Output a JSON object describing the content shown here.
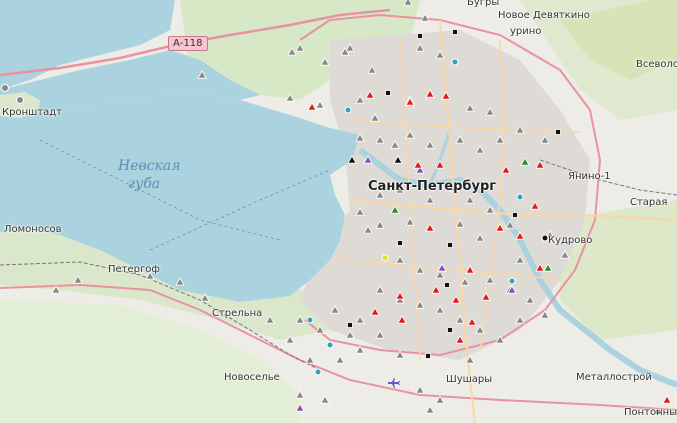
{
  "map": {
    "water_label_1": "Невская",
    "water_label_2": "губа",
    "road_shield": "А-118",
    "places": {
      "bugry": "Бугры",
      "novoe_devyatkino": "Новое Девяткино",
      "murino": "урино",
      "vsevolozhsk": "Всеволо",
      "kronshtadt": "Кронштадт",
      "spb": "Санкт-Петербург",
      "yanino": "Янино-1",
      "staraya": "Старая",
      "kudrovo": "Кудрово",
      "lomonosov": "Ломоносов",
      "peterhof": "Петергоф",
      "strelna": "Стрельна",
      "novoselye": "Новоселье",
      "shushary": "Шушары",
      "metallostroy": "Металлострой",
      "pontonny": "Понтонны"
    },
    "colors": {
      "land": "#f2efe9",
      "water": "#aad3df",
      "forest": "#c8e3b6",
      "urban": "#dcd9d4",
      "primary_road": "#fcd6a4",
      "trunk_road": "#e892a2",
      "marker_gray": "#888888",
      "marker_red": "#e01b1b",
      "marker_purple": "#8e4fb4",
      "marker_teal": "#2fa4b8",
      "marker_black": "#111111",
      "marker_green": "#2a8a2a"
    },
    "marker_types": [
      "gray-triangle",
      "red-triangle",
      "purple-triangle",
      "black-square",
      "teal-circle",
      "gray-circle",
      "green-triangle"
    ]
  }
}
